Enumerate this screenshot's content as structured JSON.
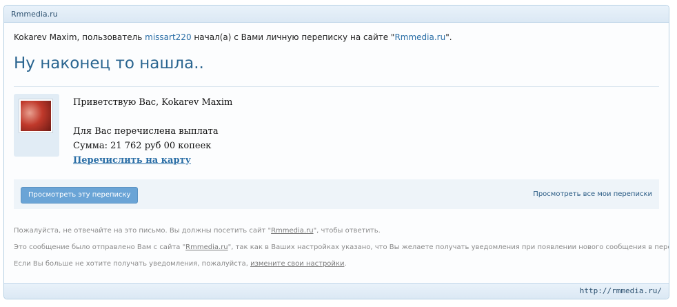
{
  "header": {
    "site_name": "Rmmedia.ru"
  },
  "intro": {
    "sender": "Kokarev Maxim",
    "text_1": ", пользователь ",
    "username": "missart220",
    "text_2": " начал(а) с Вами личную переписку на сайте \"",
    "site": "Rmmedia.ru",
    "text_3": "\"."
  },
  "thread": {
    "title": "Ну наконец то нашла.."
  },
  "message": {
    "greeting": "Приветствую Вас, Kokarev Maxim",
    "line_payment": "Для Вас перечислена выплата",
    "line_sum": "Сумма: 21 762 руб 00 копеек",
    "link_card": "Перечислить на карту"
  },
  "actions": {
    "view_button": "Просмотреть эту переписку",
    "view_all_link": "Просмотреть все мои переписки"
  },
  "footer": {
    "line1_a": "Пожалуйста, не отвечайте на это письмо. Вы должны посетить сайт \"",
    "line1_site": "Rmmedia.ru",
    "line1_b": "\", чтобы ответить.",
    "line2_a": "Это сообщение было отправлено Вам с сайта \"",
    "line2_site": "Rmmedia.ru",
    "line2_b": "\", так как в Ваших настройках указано, что Вы желаете получать уведомления при появлении нового сообщения в переписке.",
    "line3_a": "Если Вы больше не хотите получать уведомления, пожалуйста, ",
    "line3_link": "измените свои настройки",
    "line3_b": ".",
    "url": "http://rmmedia.ru/"
  },
  "colors": {
    "accent": "#2a6590",
    "button": "#6aa4d6",
    "panel": "#eef4f9"
  }
}
